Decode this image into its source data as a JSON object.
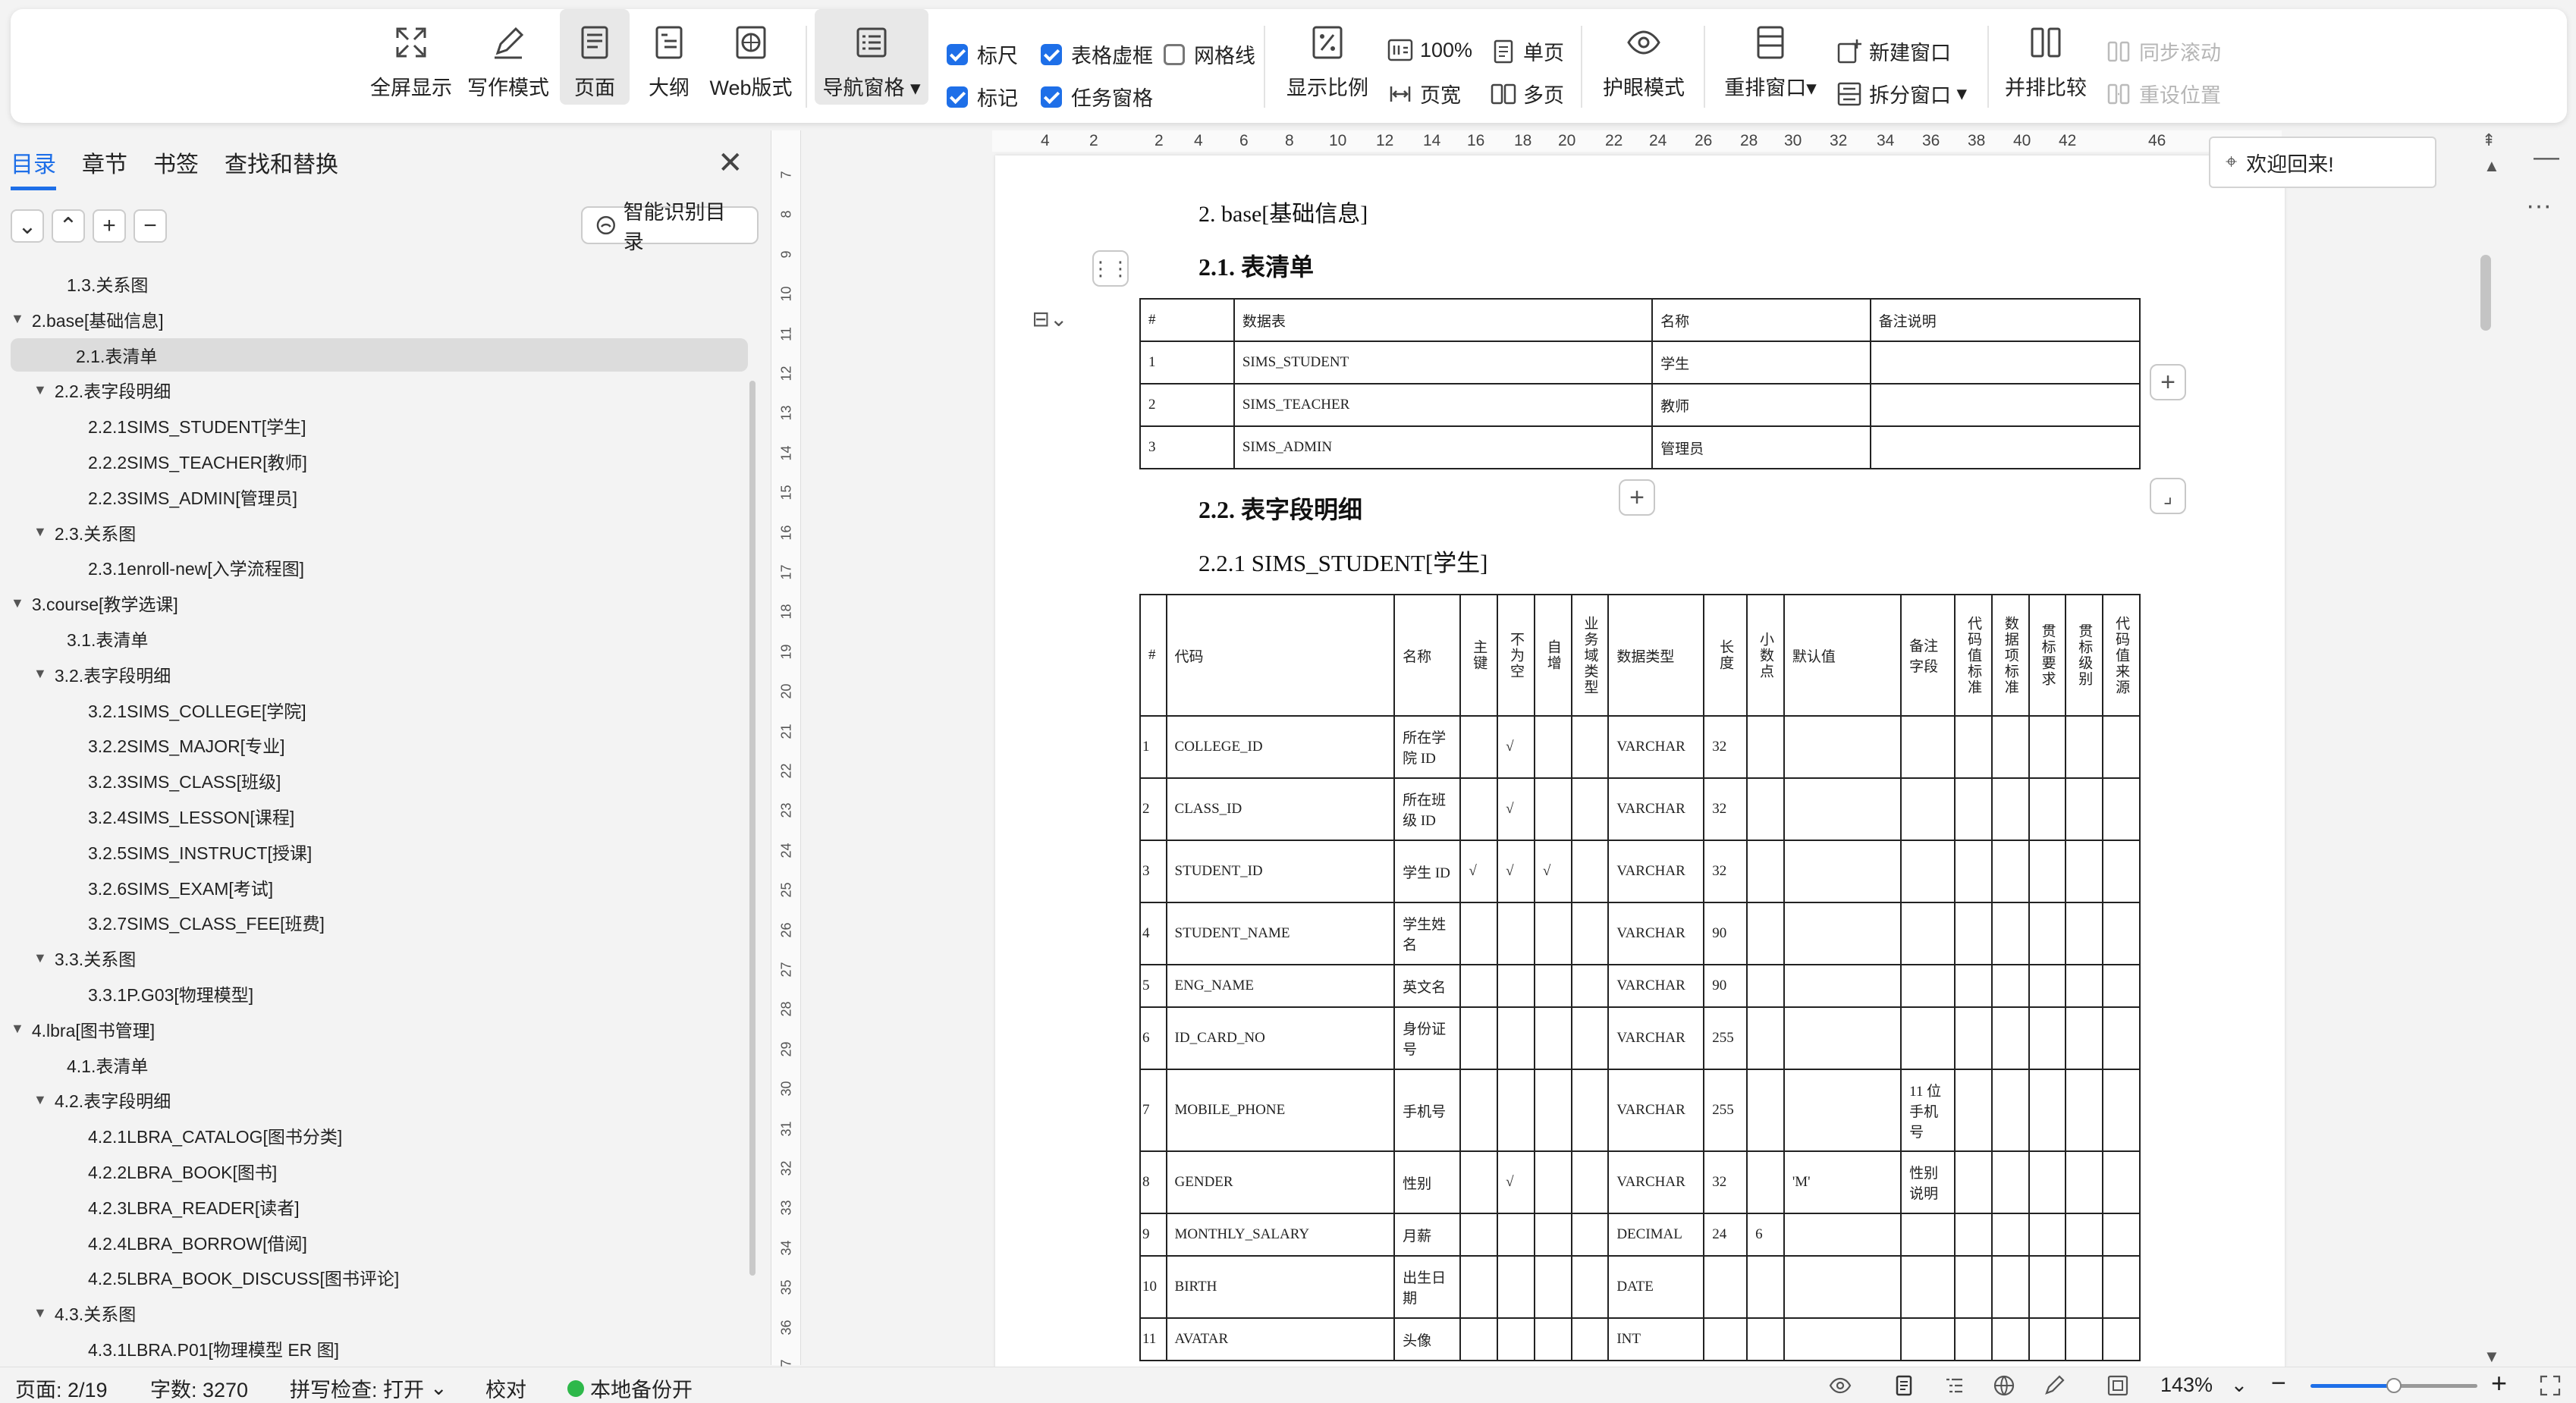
{
  "toolbar": {
    "fullscreen": "全屏显示",
    "writing_mode": "写作模式",
    "page": "页面",
    "outline": "大纲",
    "web_layout": "Web版式",
    "nav_pane": "导航窗格",
    "ruler": "标尺",
    "table_gridlines": "表格虚框",
    "gridlines": "网格线",
    "marks": "标记",
    "task_pane": "任务窗格",
    "zoom_ratio": "显示比例",
    "zoom_100": "100%",
    "page_width": "页宽",
    "single_page": "单页",
    "multi_page": "多页",
    "eye_care": "护眼模式",
    "rearrange": "重排窗口",
    "new_window": "新建窗口",
    "split_window": "拆分窗口",
    "side_by_side": "并排比较",
    "sync_scroll": "同步滚动",
    "reset_position": "重设位置"
  },
  "nav": {
    "tabs": [
      "目录",
      "章节",
      "书签",
      "查找和替换"
    ],
    "smart_toc": "智能识别目录",
    "items": [
      {
        "label": "1.3.关系图",
        "level": 1,
        "expand": ""
      },
      {
        "label": "2.base[基础信息]",
        "level": 0,
        "expand": "▼"
      },
      {
        "label": "2.1.表清单",
        "level": 1,
        "expand": ""
      },
      {
        "label": "2.2.表字段明细",
        "level": 1,
        "expand": "▼"
      },
      {
        "label": "2.2.1SIMS_STUDENT[学生]",
        "level": 2,
        "expand": ""
      },
      {
        "label": "2.2.2SIMS_TEACHER[教师]",
        "level": 2,
        "expand": ""
      },
      {
        "label": "2.2.3SIMS_ADMIN[管理员]",
        "level": 2,
        "expand": ""
      },
      {
        "label": "2.3.关系图",
        "level": 1,
        "expand": "▼"
      },
      {
        "label": "2.3.1enroll-new[入学流程图]",
        "level": 2,
        "expand": ""
      },
      {
        "label": "3.course[教学选课]",
        "level": 0,
        "expand": "▼"
      },
      {
        "label": "3.1.表清单",
        "level": 1,
        "expand": ""
      },
      {
        "label": "3.2.表字段明细",
        "level": 1,
        "expand": "▼"
      },
      {
        "label": "3.2.1SIMS_COLLEGE[学院]",
        "level": 2,
        "expand": ""
      },
      {
        "label": "3.2.2SIMS_MAJOR[专业]",
        "level": 2,
        "expand": ""
      },
      {
        "label": "3.2.3SIMS_CLASS[班级]",
        "level": 2,
        "expand": ""
      },
      {
        "label": "3.2.4SIMS_LESSON[课程]",
        "level": 2,
        "expand": ""
      },
      {
        "label": "3.2.5SIMS_INSTRUCT[授课]",
        "level": 2,
        "expand": ""
      },
      {
        "label": "3.2.6SIMS_EXAM[考试]",
        "level": 2,
        "expand": ""
      },
      {
        "label": "3.2.7SIMS_CLASS_FEE[班费]",
        "level": 2,
        "expand": ""
      },
      {
        "label": "3.3.关系图",
        "level": 1,
        "expand": "▼"
      },
      {
        "label": "3.3.1P.G03[物理模型]",
        "level": 2,
        "expand": ""
      },
      {
        "label": "4.lbra[图书管理]",
        "level": 0,
        "expand": "▼"
      },
      {
        "label": "4.1.表清单",
        "level": 1,
        "expand": ""
      },
      {
        "label": "4.2.表字段明细",
        "level": 1,
        "expand": "▼"
      },
      {
        "label": "4.2.1LBRA_CATALOG[图书分类]",
        "level": 2,
        "expand": ""
      },
      {
        "label": "4.2.2LBRA_BOOK[图书]",
        "level": 2,
        "expand": ""
      },
      {
        "label": "4.2.3LBRA_READER[读者]",
        "level": 2,
        "expand": ""
      },
      {
        "label": "4.2.4LBRA_BORROW[借阅]",
        "level": 2,
        "expand": ""
      },
      {
        "label": "4.2.5LBRA_BOOK_DISCUSS[图书评论]",
        "level": 2,
        "expand": ""
      },
      {
        "label": "4.3.关系图",
        "level": 1,
        "expand": "▼"
      },
      {
        "label": "4.3.1LBRA.P01[物理模型 ER 图]",
        "level": 2,
        "expand": ""
      }
    ]
  },
  "ruler_h": [
    "4",
    "2",
    "2",
    "4",
    "6",
    "8",
    "10",
    "12",
    "14",
    "16",
    "18",
    "20",
    "22",
    "24",
    "26",
    "28",
    "30",
    "32",
    "34",
    "36",
    "38",
    "40",
    "42",
    "46"
  ],
  "ruler_v": [
    "7",
    "8",
    "9",
    "10",
    "11",
    "12",
    "13",
    "14",
    "15",
    "16",
    "17",
    "18",
    "19",
    "20",
    "21",
    "22",
    "23",
    "24",
    "25",
    "26",
    "27",
    "28",
    "29",
    "30",
    "31",
    "32",
    "33",
    "34",
    "35",
    "36",
    "37"
  ],
  "document": {
    "h2": "2.  base[基础信息]",
    "h21": "2.1.   表清单",
    "h22": "2.2.   表字段明细",
    "h221": "2.2.1  SIMS_STUDENT[学生]",
    "table_list": {
      "headers": [
        "#",
        "数据表",
        "名称",
        "备注说明"
      ],
      "rows": [
        [
          "1",
          "SIMS_STUDENT",
          "学生",
          ""
        ],
        [
          "2",
          "SIMS_TEACHER",
          "教师",
          ""
        ],
        [
          "3",
          "SIMS_ADMIN",
          "管理员",
          ""
        ]
      ]
    },
    "field_table": {
      "headers": [
        "#",
        "代码",
        "名称",
        "主键",
        "不为空",
        "自增",
        "业务域类型",
        "数据类型",
        "长度",
        "小数点",
        "默认值",
        "备注字段",
        "代码值标准",
        "数据项标准",
        "贯标要求",
        "贯标级别",
        "代码值来源"
      ],
      "rows": [
        [
          "1",
          "COLLEGE_ID",
          "所在学院 ID",
          "",
          "√",
          "",
          "",
          "VARCHAR",
          "32",
          "",
          "",
          "",
          "",
          "",
          "",
          "",
          ""
        ],
        [
          "2",
          "CLASS_ID",
          "所在班级 ID",
          "",
          "√",
          "",
          "",
          "VARCHAR",
          "32",
          "",
          "",
          "",
          "",
          "",
          "",
          "",
          ""
        ],
        [
          "3",
          "STUDENT_ID",
          "学生 ID",
          "√",
          "√",
          "√",
          "",
          "VARCHAR",
          "32",
          "",
          "",
          "",
          "",
          "",
          "",
          "",
          ""
        ],
        [
          "4",
          "STUDENT_NAME",
          "学生姓名",
          "",
          "",
          "",
          "",
          "VARCHAR",
          "90",
          "",
          "",
          "",
          "",
          "",
          "",
          "",
          ""
        ],
        [
          "5",
          "ENG_NAME",
          "英文名",
          "",
          "",
          "",
          "",
          "VARCHAR",
          "90",
          "",
          "",
          "",
          "",
          "",
          "",
          "",
          ""
        ],
        [
          "6",
          "ID_CARD_NO",
          "身份证号",
          "",
          "",
          "",
          "",
          "VARCHAR",
          "255",
          "",
          "",
          "",
          "",
          "",
          "",
          "",
          ""
        ],
        [
          "7",
          "MOBILE_PHONE",
          "手机号",
          "",
          "",
          "",
          "",
          "VARCHAR",
          "255",
          "",
          "",
          "11 位手机号",
          "",
          "",
          "",
          "",
          ""
        ],
        [
          "8",
          "GENDER",
          "性别",
          "",
          "√",
          "",
          "",
          "VARCHAR",
          "32",
          "",
          "'M'",
          "性别说明",
          "",
          "",
          "",
          "",
          ""
        ],
        [
          "9",
          "MONTHLY_SALARY",
          "月薪",
          "",
          "",
          "",
          "",
          "DECIMAL",
          "24",
          "6",
          "",
          "",
          "",
          "",
          "",
          "",
          ""
        ],
        [
          "10",
          "BIRTH",
          "出生日期",
          "",
          "",
          "",
          "",
          "DATE",
          "",
          "",
          "",
          "",
          "",
          "",
          "",
          "",
          ""
        ],
        [
          "11",
          "AVATAR",
          "头像",
          "",
          "",
          "",
          "",
          "INT",
          "",
          "",
          "",
          "",
          "",
          "",
          "",
          "",
          ""
        ]
      ]
    }
  },
  "welcome": "欢迎回来!",
  "status": {
    "page": "页面: 2/19",
    "words": "字数: 3270",
    "spell": "拼写检查: 打开",
    "proof": "校对",
    "backup": "本地备份开",
    "zoom": "143%",
    "zoom_level_pct": 50
  },
  "colors": {
    "accent": "#1e6fe8",
    "backup_dot": "#2eb84a"
  }
}
